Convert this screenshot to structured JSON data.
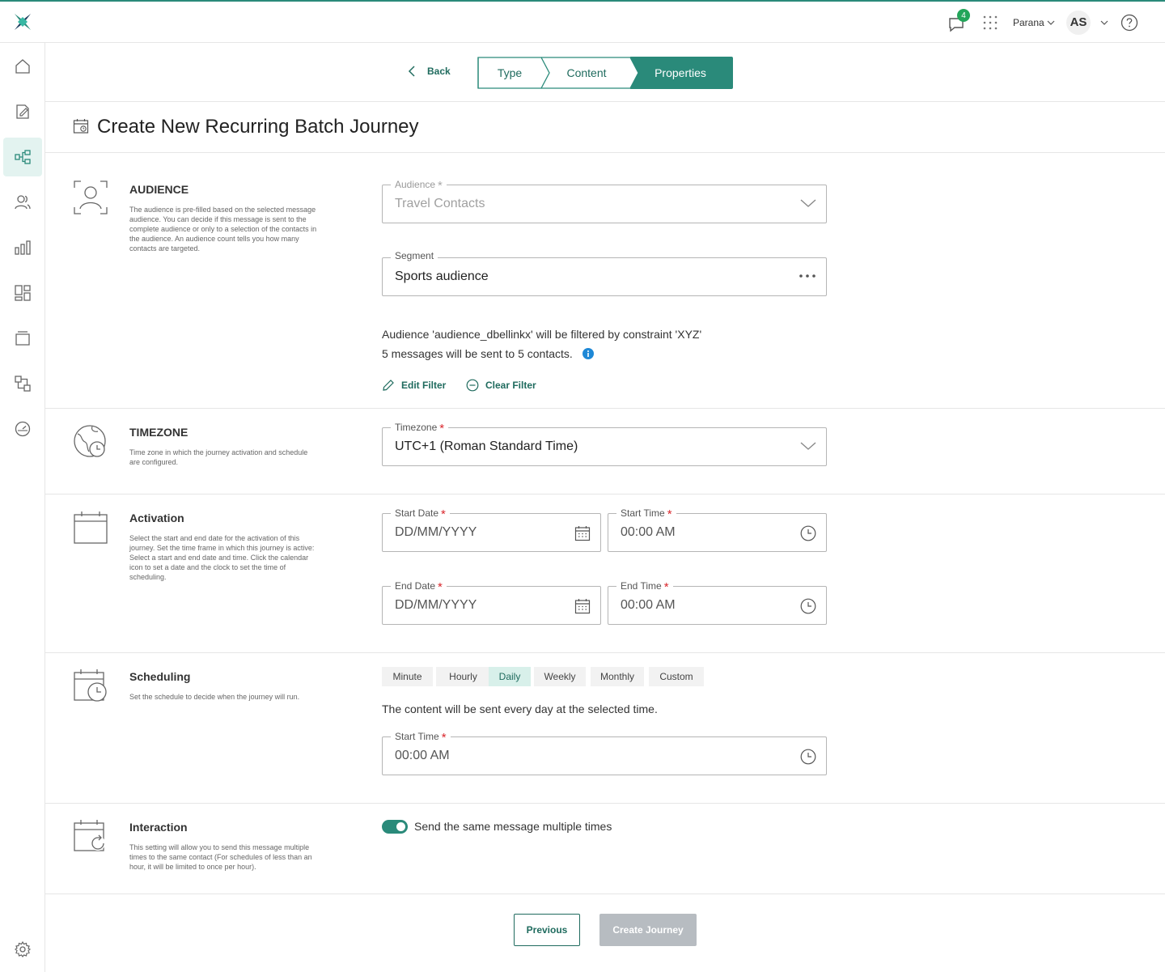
{
  "header": {
    "notifications_count": "4",
    "workspace": "Parana",
    "user_initials": "AS"
  },
  "stepper": {
    "back_label": "Back",
    "steps": [
      "Type",
      "Content",
      "Properties"
    ],
    "active_step": "Properties"
  },
  "page": {
    "title": "Create New Recurring Batch Journey"
  },
  "audience": {
    "title": "AUDIENCE",
    "description": "The audience is pre-filled based on the selected message audience. You can decide if this message is sent to the complete audience or only to a selection of the contacts in the audience. An audience count tells you how many contacts are targeted.",
    "audience_label": "Audience",
    "audience_value": "Travel Contacts",
    "segment_label": "Segment",
    "segment_value": "Sports audience",
    "filter_text": "Audience 'audience_dbellinkx' will be filtered by constraint 'XYZ'",
    "count_text": "5 messages will be sent to 5 contacts.",
    "edit_filter": "Edit Filter",
    "clear_filter": "Clear Filter"
  },
  "timezone": {
    "title": "TIMEZONE",
    "description": "Time zone in which the journey activation and schedule are configured.",
    "label": "Timezone",
    "value": "UTC+1 (Roman Standard Time)"
  },
  "activation": {
    "title": "Activation",
    "description": "Select the start and end date for the activation of this journey. Set the time frame in which this journey is active: Select a start and end date and time. Click the calendar icon to set a date and the clock to set the time of scheduling.",
    "start_date_label": "Start Date",
    "start_date_value": "DD/MM/YYYY",
    "start_time_label": "Start Time",
    "start_time_value": "00:00 AM",
    "end_date_label": "End Date",
    "end_date_value": "DD/MM/YYYY",
    "end_time_label": "End Time",
    "end_time_value": "00:00 AM"
  },
  "scheduling": {
    "title": "Scheduling",
    "description": "Set the schedule to decide when the journey will run.",
    "frequencies": [
      "Minute",
      "Hourly",
      "Daily",
      "Weekly",
      "Monthly",
      "Custom"
    ],
    "selected": "Daily",
    "info": "The content will be sent every day at the selected time.",
    "start_time_label": "Start Time",
    "start_time_value": "00:00 AM"
  },
  "interaction": {
    "title": "Interaction",
    "description": "This setting will allow you to send this message multiple times to the same contact (For schedules of less than an hour, it will be limited to once per hour).",
    "toggle_label": "Send the same message multiple times",
    "toggle_on": true
  },
  "footer": {
    "previous": "Previous",
    "create": "Create Journey"
  },
  "colors": {
    "accent": "#2a8a7a",
    "accent_dark": "#1f6b5e",
    "required": "#d9262c",
    "badge": "#23a55a",
    "disabled_button": "#b7bcc1"
  }
}
